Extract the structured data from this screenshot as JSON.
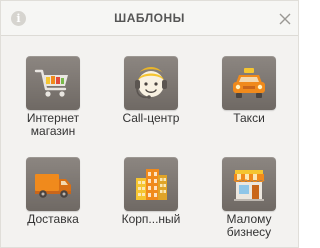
{
  "dialog": {
    "title": "ШАБЛОНЫ",
    "info_icon": "info-icon",
    "info_glyph": "i",
    "close_icon": "close-icon"
  },
  "templates": [
    {
      "icon": "shopping-cart-icon",
      "label_lines": [
        "Интернет",
        "магазин"
      ]
    },
    {
      "icon": "call-center-operator-icon",
      "label_lines": [
        "Call-центр"
      ]
    },
    {
      "icon": "taxi-icon",
      "label_lines": [
        "Такси"
      ]
    },
    {
      "icon": "delivery-truck-icon",
      "label_lines": [
        "Доставка"
      ]
    },
    {
      "icon": "office-buildings-icon",
      "label_lines": [
        "Корп...ный"
      ]
    },
    {
      "icon": "small-shop-icon",
      "label_lines": [
        "Малому",
        "бизнесу"
      ]
    }
  ],
  "colors": {
    "tile_bg": "#7d7772",
    "accent_orange": "#f08a1c",
    "accent_yellow": "#f5c531"
  }
}
